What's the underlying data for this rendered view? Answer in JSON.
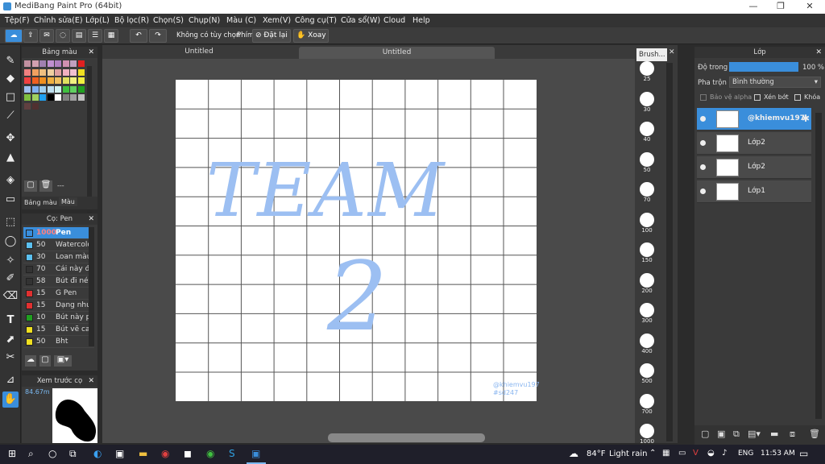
{
  "window": {
    "title": "MediBang Paint Pro (64bit)",
    "minimize": "—",
    "restore": "❐",
    "close": "✕"
  },
  "menu": [
    "Tệp(F)",
    "Chỉnh sửa(E)",
    "Lớp(L)",
    "Bộ lọc(R)",
    "Chọn(S)",
    "Chụp(N)",
    "Màu (C)",
    "Xem(V)",
    "Công cụ(T)",
    "Cửa sổ(W)",
    "Cloud",
    "Help"
  ],
  "toolbar": {
    "no_option": "Không có tùy chọn",
    "key_label": "Phím",
    "reset_label": "Đặt lại",
    "rotate_label": "Xoay"
  },
  "tabs": {
    "tab1": "Untitled",
    "tab2": "Untitled"
  },
  "color_panel": {
    "title": "Bảng màu",
    "tab_palette": "Bảng màu",
    "tab_color": "Màu",
    "dash": "---"
  },
  "brush_panel": {
    "title": "Cọ: Pen",
    "items": [
      {
        "size": "1000",
        "name": "Pen",
        "color": "#3a8edb"
      },
      {
        "size": "50",
        "name": "Watercolor",
        "color": "#5bc0f0"
      },
      {
        "size": "30",
        "name": "Loan màu",
        "color": "#5bc0f0"
      },
      {
        "size": "70",
        "name": "Cái này để",
        "color": "#333333"
      },
      {
        "size": "58",
        "name": "Bút đi nét",
        "color": "#333333"
      },
      {
        "size": "15",
        "name": "G Pen",
        "color": "#e03030"
      },
      {
        "size": "15",
        "name": "Dạng nhu",
        "color": "#e03030"
      },
      {
        "size": "10",
        "name": "Bút này p",
        "color": "#20a020"
      },
      {
        "size": "15",
        "name": "Bút vẽ ca",
        "color": "#f0e020"
      },
      {
        "size": "50",
        "name": "Bht",
        "color": "#f0e020"
      }
    ]
  },
  "preview_panel": {
    "title": "Xem trước cọ",
    "zoom": "84.67m"
  },
  "brush_sizes": [
    "25",
    "30",
    "40",
    "50",
    "70",
    "100",
    "150",
    "200",
    "300",
    "400",
    "500",
    "700",
    "1000"
  ],
  "brush_window_title": "Brush...",
  "layer_panel": {
    "title": "Lớp",
    "opacity_label": "Độ trong",
    "opacity_value": "100 %",
    "opacity": 1.0,
    "blend_label": "Pha trộn",
    "blend_value": "Bình thường",
    "protect_alpha": "Bảo vệ alpha",
    "clip": "Xén bớt",
    "lock": "Khóa",
    "layers": [
      {
        "name": "@khiemvu197",
        "selected": true
      },
      {
        "name": "Lớp2",
        "selected": false
      },
      {
        "name": "Lớp2",
        "selected": false
      },
      {
        "name": "Lớp1",
        "selected": false
      }
    ]
  },
  "canvas_art": {
    "line1": "TEAM",
    "line2": "2",
    "signature1": "@khiemvu197",
    "signature2": "#sd247"
  },
  "taskbar": {
    "weather_temp": "84°F",
    "weather_desc": "Light rain",
    "lang": "ENG",
    "time": "11:53 AM"
  }
}
